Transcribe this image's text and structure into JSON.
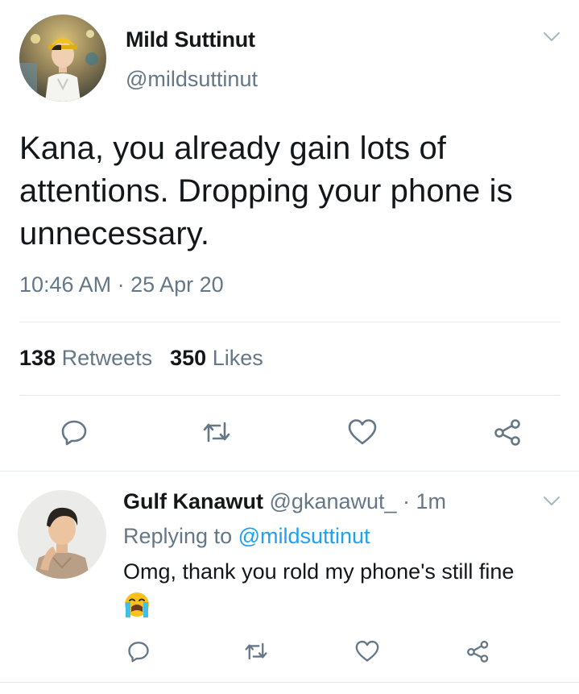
{
  "tweet": {
    "author_name": "Mild Suttinut",
    "author_handle": "@mildsuttinut",
    "text": "Kana, you already gain lots of attentions. Dropping your phone is unnecessary.",
    "timestamp": "10:46 AM · 25 Apr 20",
    "retweet_count": "138",
    "retweet_label": "Retweets",
    "like_count": "350",
    "like_label": "Likes"
  },
  "reply": {
    "author_name": "Gulf Kanawut",
    "author_handle": "@gkanawut_",
    "separator": " · ",
    "age": "1m",
    "replying_to_prefix": "Replying to ",
    "replying_to_handle": "@mildsuttinut",
    "text": "Omg, thank you rold my phone's still fine",
    "emoji_icon": "loudly-crying-face-icon"
  },
  "colors": {
    "primary_text": "#14171a",
    "secondary_text": "#657786",
    "link": "#1da1f2",
    "icon": "#657786",
    "divider": "#e1e8ed"
  },
  "icons": {
    "caret": "chevron-down-icon",
    "reply": "reply-icon",
    "retweet": "retweet-icon",
    "like": "heart-icon",
    "share": "share-icon"
  }
}
